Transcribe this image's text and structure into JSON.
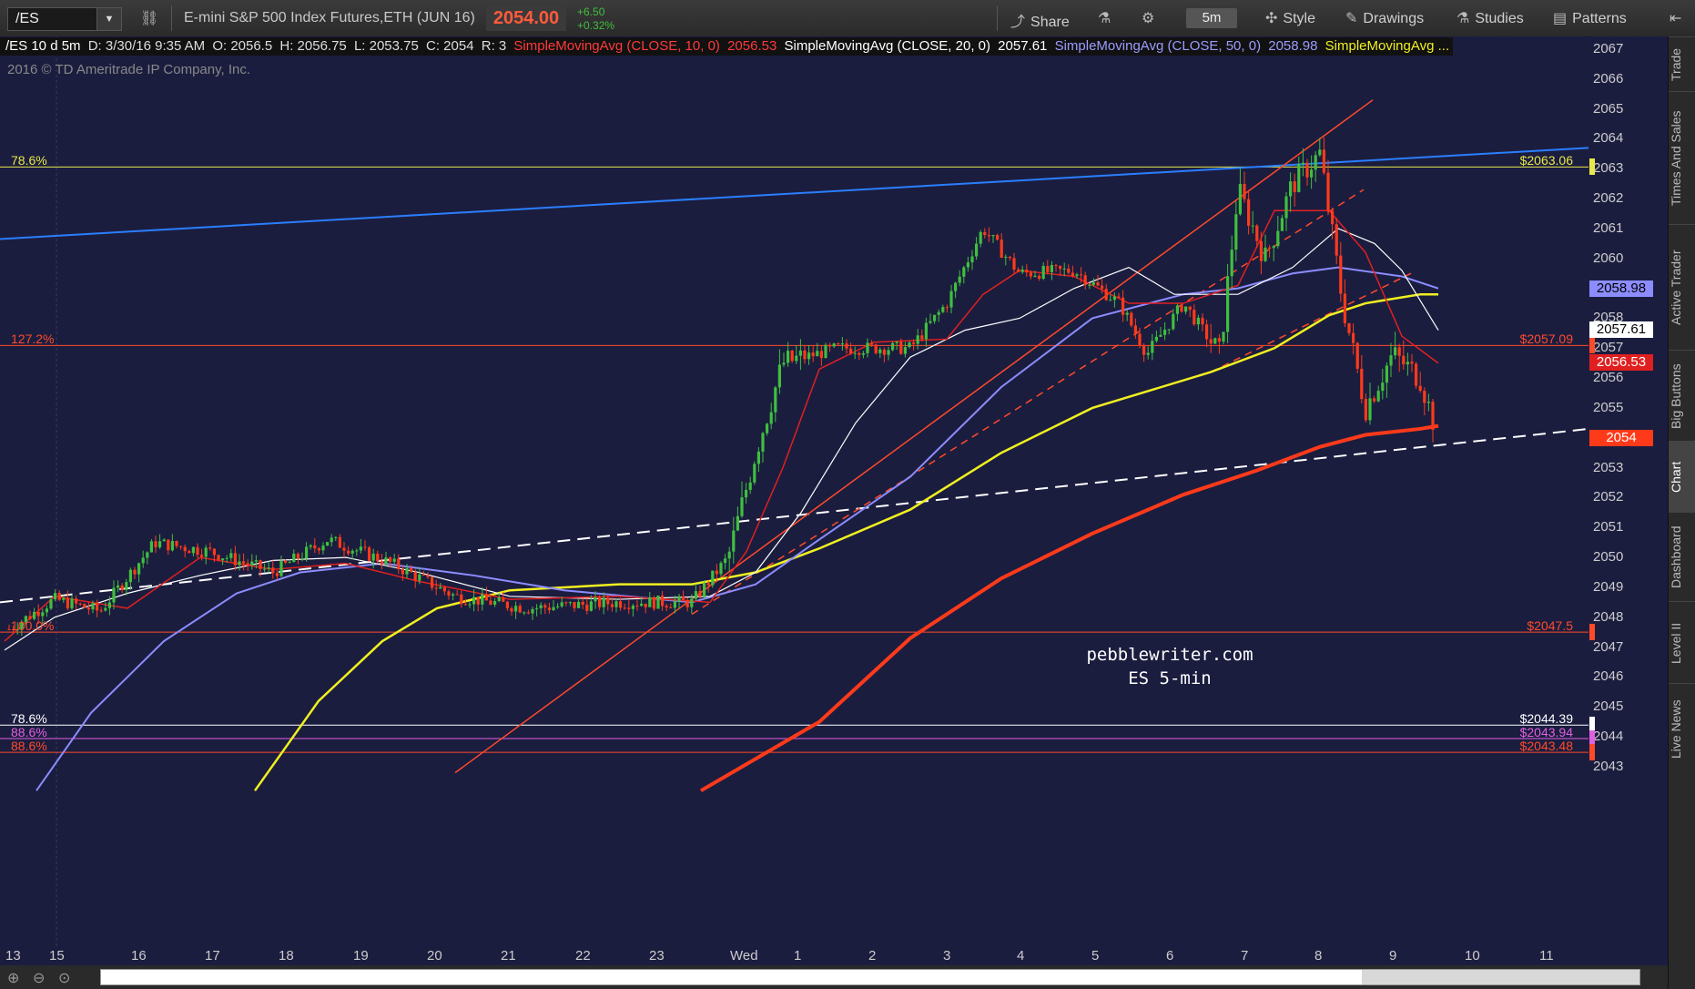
{
  "toolbar": {
    "symbol": "/ES",
    "description": "E-mini S&P 500 Index Futures,ETH (JUN 16)",
    "last_price": "2054.00",
    "change": "+6.50",
    "change_pct": "+0.32%",
    "share_label": "Share",
    "timeframe": "5m",
    "style_label": "Style",
    "drawings_label": "Drawings",
    "studies_label": "Studies",
    "patterns_label": "Patterns"
  },
  "study_bar": {
    "symbol_info": "/ES 10 d 5m",
    "date": "D: 3/30/16 9:35 AM",
    "open": "O: 2056.5",
    "high": "H: 2056.75",
    "low": "L: 2053.75",
    "close": "C: 2054",
    "range": "R: 3",
    "sma10_label": "SimpleMovingAvg (CLOSE, 10, 0)",
    "sma10_value": "2056.53",
    "sma20_label": "SimpleMovingAvg (CLOSE, 20, 0)",
    "sma20_value": "2057.61",
    "sma50_label": "SimpleMovingAvg (CLOSE, 50, 0)",
    "sma50_value": "2058.98",
    "sma_more": "SimpleMovingAvg ..."
  },
  "copyright": "2016 © TD Ameritrade IP Company, Inc.",
  "watermark": {
    "line1": "pebblewriter.com",
    "line2": "ES 5-min"
  },
  "fib_levels": [
    {
      "label": "78.6%",
      "price": "$2063.06",
      "color": "#e8e84a"
    },
    {
      "label": "127.2%",
      "price": "$2057.09",
      "color": "#ff4a2a"
    },
    {
      "label": "100.0%",
      "price": "$2047.5",
      "color": "#ff4a2a"
    },
    {
      "label": "78.6%",
      "price": "$2044.39",
      "color": "#ffffff"
    },
    {
      "label": "88.6%",
      "price": "$2043.94",
      "color": "#e060e0"
    },
    {
      "label": "88.6%",
      "price": "$2043.48",
      "color": "#ff4a2a"
    }
  ],
  "price_axis": [
    "2067",
    "2066",
    "2065",
    "2064",
    "2063",
    "2062",
    "2061",
    "2060",
    "2059",
    "2058",
    "2057",
    "2056",
    "2055",
    "2054",
    "2053",
    "2052",
    "2051",
    "2050",
    "2049",
    "2048",
    "2047",
    "2046",
    "2045",
    "2044",
    "2043"
  ],
  "price_tags": [
    {
      "value": "2058.98",
      "color": "#8c8cff"
    },
    {
      "value": "2057.61",
      "color": "#ffffff"
    },
    {
      "value": "2056.53",
      "color": "#e02020"
    },
    {
      "value": "2054",
      "color": "#ff3a1a"
    }
  ],
  "time_axis": [
    "13",
    "15",
    "16",
    "17",
    "18",
    "19",
    "20",
    "21",
    "22",
    "23",
    "Wed",
    "1",
    "2",
    "3",
    "4",
    "5",
    "6",
    "7",
    "8",
    "9",
    "10",
    "11"
  ],
  "side_tabs": [
    "Trade",
    "Times And Sales",
    "Active Trader",
    "Big Buttons",
    "Chart",
    "Dashboard",
    "Level II",
    "Live News"
  ],
  "colors": {
    "background": "#1b1d3f",
    "up_candle": "#3fbf3f",
    "down_candle": "#ff3a1a",
    "sma10": "#e02020",
    "sma20": "#ffffff",
    "sma50": "#8c8cff",
    "sma100": "#f0f020",
    "sma200": "#ff3a1a",
    "trend_blue": "#2a7fff"
  }
}
